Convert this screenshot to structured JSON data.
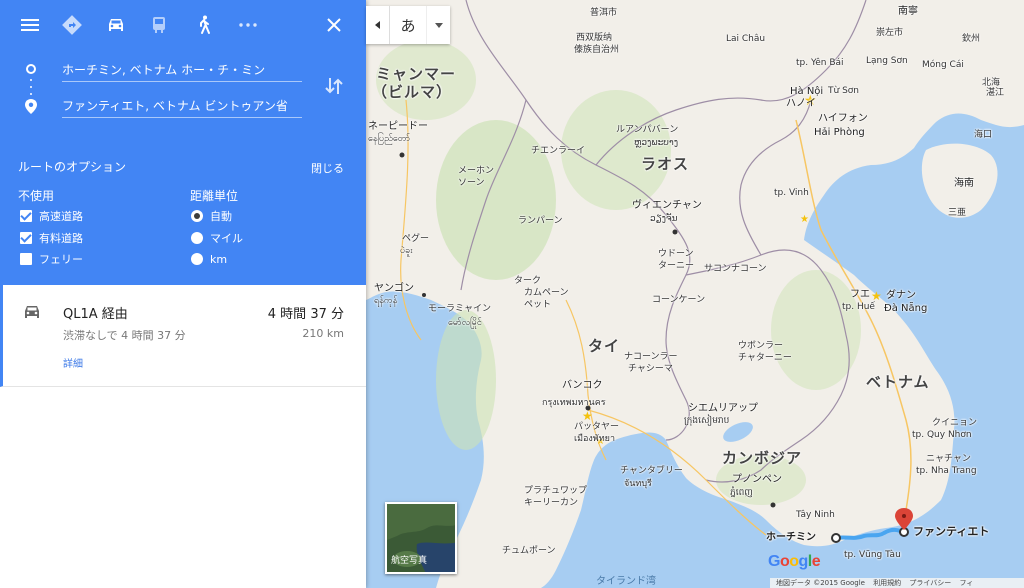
{
  "modes": [
    "menu-icon",
    "directions-icon",
    "car-icon",
    "transit-icon",
    "walk-icon",
    "more-icon",
    "close-icon"
  ],
  "origin": "ホーチミン, ベトナム ホー・チ・ミン",
  "destination": "ファンティエト, ベトナム ビントゥアン省",
  "options": {
    "title": "ルートのオプション",
    "close": "閉じる",
    "avoid_heading": "不使用",
    "avoid": [
      {
        "label": "高速道路",
        "checked": true
      },
      {
        "label": "有料道路",
        "checked": true
      },
      {
        "label": "フェリー",
        "checked": false
      }
    ],
    "units_heading": "距離単位",
    "units": [
      {
        "label": "自動",
        "selected": true
      },
      {
        "label": "マイル",
        "selected": false
      },
      {
        "label": "km",
        "selected": false
      }
    ]
  },
  "route": {
    "name": "QL1A 経由",
    "time": "4 時間 37 分",
    "sub": "渋滞なしで 4 時間 37 分",
    "distance": "210 km",
    "details": "詳細"
  },
  "lang_button": "あ",
  "satellite_label": "航空写真",
  "google_logo": "Google",
  "footer": [
    "地図データ ©2015 Google",
    "利用規約",
    "プライバシー",
    "フィ"
  ],
  "map_labels": {
    "myanmar": "ミャンマー",
    "myanmar2": "（ビルマ）",
    "laos": "ラオス",
    "thai": "タイ",
    "vietnam": "ベトナム",
    "cambodia": "カンボジア",
    "hanoi": "ハノイ",
    "hanoi_en": "Hà Nội",
    "haiphong": "ハイフォン",
    "haiphong_en": "Hải Phòng",
    "vinh": "tp. Vinh",
    "vientiane": "ヴィエンチャン",
    "vientiane_lo": "ວຽງຈັນ",
    "bangkok": "バンコク",
    "bangkok_th": "กรุงเทพมหานคร",
    "pattaya": "パッタヤー",
    "pattaya_th": "เมืองพัทยา",
    "siemreap": "シエムリアップ",
    "siemreap_km": "ក្រុងសៀមរាប",
    "phnompenh": "プノンペン",
    "phnompenh_km": "ភ្នំពេញ",
    "hcm": "ホーチミン",
    "phanthiet": "ファンティエト",
    "vungtau": "tp. Vũng Tàu",
    "danang": "ダナン",
    "danang_en": "Đà Nẵng",
    "hue": "フエ",
    "hue_en": "tp. Huế",
    "quinhon": "クイニョン",
    "quinhon_en": "tp. Quy Nhơn",
    "nhatrang": "ニャチャン",
    "nhatrang_en": "tp. Nha Trang",
    "napyidaw": "ネーピードー",
    "napyidaw_my": "နေပြည်တော်",
    "yangon": "ヤンゴン",
    "yangon_my": "ရန်ကုန်",
    "pego": "ペグー",
    "pego_my": "ပဲခူး",
    "mawlamyine": "モーラミャイン",
    "mawlamyine_my": "မော်လမြိုင်",
    "chiangrai": "チエンラーイ",
    "luangprabang": "ルアンパバーン",
    "luangprabang_lo": "ຫຼວງພະບາງ",
    "lampang": "ランパーン",
    "udon": "ウドーン",
    "udon2": "ターニー",
    "sakon": "サコンナコーン",
    "khonkaen": "コーンケーン",
    "ubon": "ウボンラー",
    "ubon2": "チャターニー",
    "nakhon": "ナコーンラー",
    "nakhon2": "チャシーマ",
    "takh": "ターク",
    "kamphaeng": "カムペーン",
    "kamphaeng2": "ペット",
    "chanthaburi": "チャンタブリー",
    "chanthaburi_th": "จันทบุรี",
    "prachuap": "プラチュワップ",
    "prachuap2": "キーリーカン",
    "chumphon": "チュムポーン",
    "mehong": "メーホン",
    "mehong2": "ソーン",
    "nanning": "南寧",
    "chongzuo": "崇左市",
    "qinzhou": "欽州",
    "beihai": "北海",
    "zhanjiang": "湛江",
    "haikou": "海口",
    "hainan": "海南",
    "sanya": "三亜",
    "puer": "普洱市",
    "xishuang": "西双版纳",
    "xishuang2": "傣族自治州",
    "tp_yen": "tp. Yên Bái",
    "lai_chau": "Lai Châu",
    "tay_ninh": "Tây Ninh",
    "lang_son": "Lạng Sơn",
    "mong_cai": "Móng Cái",
    "tu_son": "Từ Sơn",
    "gulf": "タイランド湾"
  }
}
